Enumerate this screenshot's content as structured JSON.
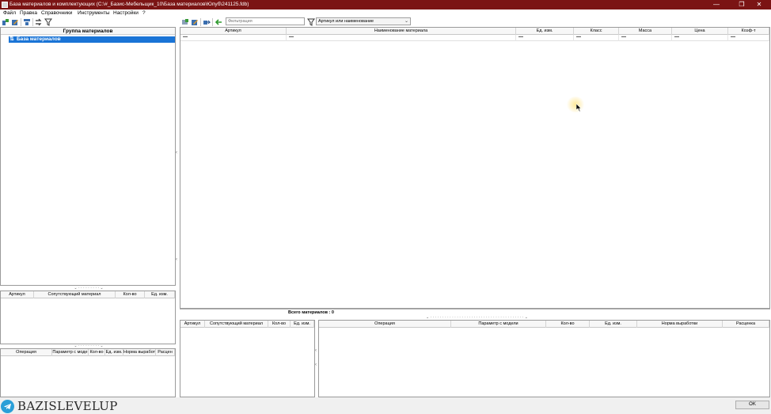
{
  "window": {
    "title": "База материалов и комплектующих   (C:\\#_Базис-Мебельщик_10\\База материалов\\Юпуб\\241125.fdb)",
    "minimize": "—",
    "maximize": "❐",
    "close": "✕"
  },
  "menu": [
    "Файл",
    "Правка",
    "Справочники",
    "Инструменты",
    "Настройки",
    "?"
  ],
  "filter": {
    "placeholder": "Фильтрация",
    "mode": "Артикул или наименование"
  },
  "tree": {
    "header": "Группа материалов",
    "root": "База материалов"
  },
  "materials_grid": {
    "columns": [
      "Артикул",
      "Наименование материала",
      "Ед. изм.",
      "Класс",
      "Масса",
      "Цена",
      "Коэф-т"
    ],
    "rows": [
      [
        "—",
        "—",
        "—",
        "—",
        "—",
        "—",
        "—"
      ]
    ]
  },
  "summary": {
    "total": "Всего материалов : 0"
  },
  "companion_left": {
    "columns": [
      "Артикул",
      "Сопутствующий материал",
      "Кол-во",
      "Ед. изм."
    ]
  },
  "operations_left": {
    "columns": [
      "Операция",
      "Параметр с моде",
      "Кол-во",
      "Ед. изм.",
      "Норма выработ",
      "Расцен"
    ]
  },
  "companion_bottom": {
    "columns": [
      "Артикул",
      "Сопутствующий материал",
      "Кол-во",
      "Ед. изм."
    ]
  },
  "operations_bottom": {
    "columns": [
      "Операция",
      "Параметр с модели",
      "Кол-во",
      "Ед. изм.",
      "Норма выработки",
      "Расценка"
    ]
  },
  "watermark": "BAZISLEVELUP",
  "ok_button": "OK",
  "colors": {
    "titlebar": "#7b1414",
    "selection": "#1a74d6",
    "telegram": "#2a9fd8"
  }
}
